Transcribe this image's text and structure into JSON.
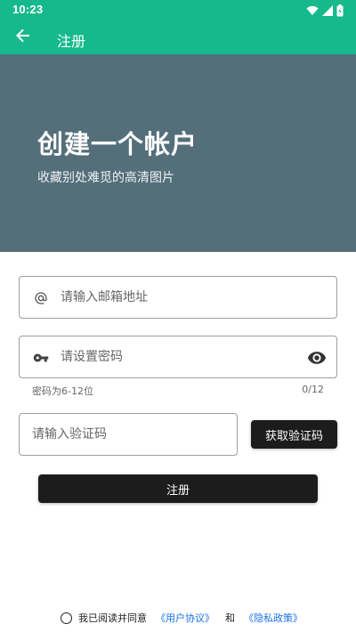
{
  "status_bar": {
    "time": "10:23",
    "icons": [
      "wifi-icon",
      "cellular-signal-icon",
      "battery-charging-icon"
    ]
  },
  "app_bar": {
    "title": "注册",
    "back_icon": "arrow-back-icon"
  },
  "hero": {
    "title": "创建一个帐户",
    "subtitle": "收藏别处难觅的高清图片"
  },
  "form": {
    "email": {
      "placeholder": "请输入邮箱地址",
      "value": "",
      "icon": "at-sign-icon"
    },
    "password": {
      "placeholder": "请设置密码",
      "value": "",
      "icon": "key-icon",
      "visibility_icon": "eye-icon",
      "helper": "密码为6-12位",
      "counter": "0/12"
    },
    "code": {
      "placeholder": "请输入验证码",
      "value": ""
    },
    "get_code_label": "获取验证码",
    "register_label": "注册"
  },
  "agreement": {
    "text": "我已阅读并同意",
    "user_agreement": "《用户协议》",
    "and": "和",
    "privacy_policy": "《隐私政策》",
    "checked": false
  },
  "colors": {
    "primary": "#16b98c",
    "hero_bg": "#546e7a",
    "button_bg": "#1c1c1c",
    "link": "#1a73e8"
  }
}
